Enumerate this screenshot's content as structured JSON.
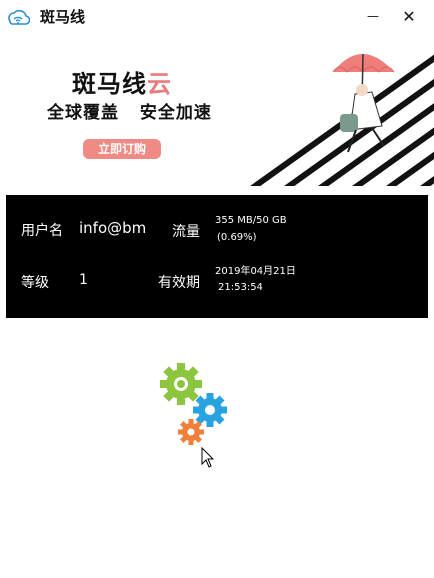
{
  "window": {
    "title": "斑马线",
    "minimize_glyph": "—",
    "close_glyph": "✕"
  },
  "banner": {
    "brand_main": "斑马线",
    "brand_accent": "云",
    "slogan": "全球覆盖 安全加速",
    "subscribe_label": "立即订购"
  },
  "account": {
    "username_label": "用户名",
    "username_value": "info@bm",
    "traffic_label": "流量",
    "traffic_value": "355 MB/50 GB",
    "traffic_percent": "(0.69%)",
    "level_label": "等级",
    "level_value": "1",
    "expiry_label": "有效期",
    "expiry_date": "2019年04月21日",
    "expiry_time": "21:53:54"
  },
  "loading": {
    "gear_colors": [
      "#8cc63f",
      "#29a3e0",
      "#f07f3c"
    ],
    "icon": "gears-loading-icon"
  }
}
